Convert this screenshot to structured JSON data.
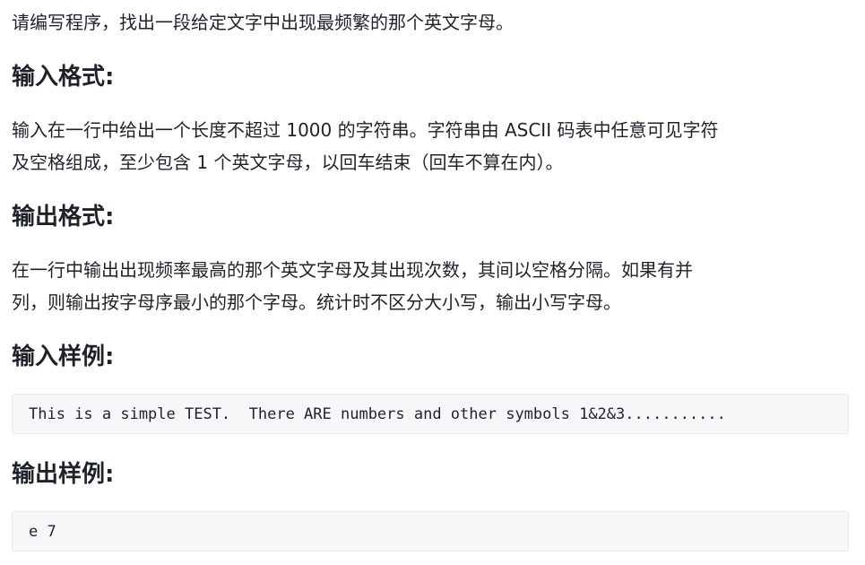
{
  "problem": {
    "intro": "请编写程序，找出一段给定文字中出现最频繁的那个英文字母。",
    "input_format": {
      "heading": "输入格式:",
      "lines": [
        "输入在一行中给出一个长度不超过 1000 的字符串。字符串由 ASCII 码表中任意可见字符",
        "及空格组成，至少包含 1 个英文字母，以回车结束（回车不算在内）。"
      ]
    },
    "output_format": {
      "heading": "输出格式:",
      "lines": [
        "在一行中输出出现频率最高的那个英文字母及其出现次数，其间以空格分隔。如果有并",
        "列，则输出按字母序最小的那个字母。统计时不区分大小写，输出小写字母。"
      ]
    },
    "sample_input": {
      "heading": "输入样例:",
      "code": "This is a simple TEST.  There ARE numbers and other symbols 1&2&3..........."
    },
    "sample_output": {
      "heading": "输出样例:",
      "code": "e 7"
    }
  }
}
